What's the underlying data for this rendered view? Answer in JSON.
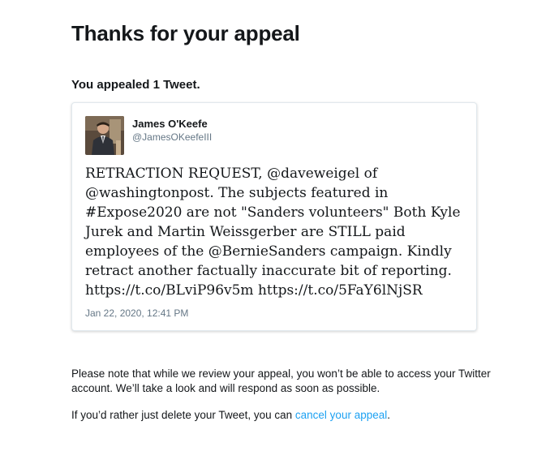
{
  "page": {
    "title": "Thanks for your appeal",
    "appealed_text": "You appealed 1 Tweet."
  },
  "tweet": {
    "author_name": "James O'Keefe",
    "author_handle": "@JamesOKeefeIII",
    "text": "RETRACTION REQUEST, @daveweigel of @washingtonpost. The subjects featured in #Expose2020 are not \"Sanders volunteers\" Both Kyle Jurek and Martin Weissgerber are STILL paid employees of the @BernieSanders campaign. Kindly retract another factually inaccurate bit of reporting. https://t.co/BLviP96v5m https://t.co/5FaY6lNjSR",
    "date": "Jan 22, 2020, 12:41 PM"
  },
  "footer": {
    "note": "Please note that while we review your appeal, you won’t be able to access your Twitter account. We’ll take a look and will respond as soon as possible.",
    "delete_prefix": "If you’d rather just delete your Tweet, you can ",
    "cancel_link": "cancel your appeal",
    "delete_suffix": "."
  },
  "colors": {
    "link": "#1da1f2",
    "secondary_text": "#657786",
    "card_border": "#e1e8ed"
  }
}
